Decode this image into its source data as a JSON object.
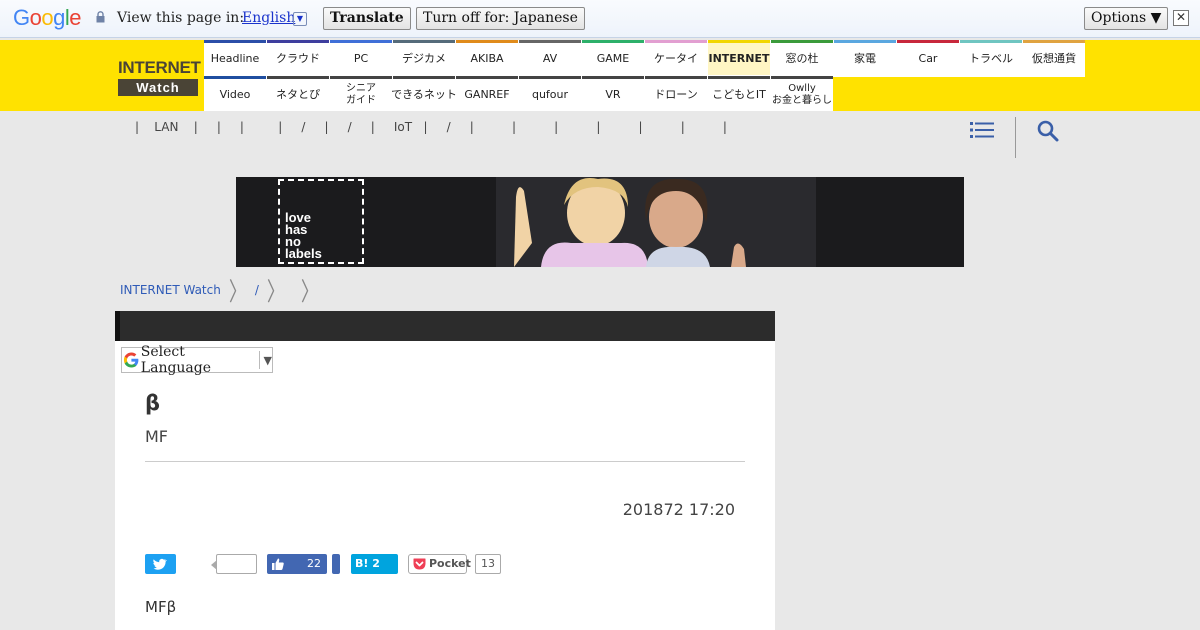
{
  "translate_bar": {
    "logo": "Google",
    "view_text": "View this page in:",
    "language": "English",
    "translate_label": "Translate",
    "turn_off_label": "Turn off for: Japanese",
    "options_label": "Options ▼",
    "close_label": "✕"
  },
  "site": {
    "logo_top": "INTERNET",
    "logo_bottom": "Watch",
    "nav_row1": [
      {
        "label": "Headline",
        "color": "#2b4ea8"
      },
      {
        "label": "クラウド",
        "color": "#3e3e9e"
      },
      {
        "label": "PC",
        "color": "#3f6fd8"
      },
      {
        "label": "デジカメ",
        "color": "#556b7a"
      },
      {
        "label": "AKIBA",
        "color": "#e08b1b"
      },
      {
        "label": "AV",
        "color": "#666666"
      },
      {
        "label": "GAME",
        "color": "#2db06a"
      },
      {
        "label": "ケータイ",
        "color": "#e29fd1"
      },
      {
        "label": "INTERNET",
        "color": "#f2d600"
      },
      {
        "label": "窓の杜",
        "color": "#3b9b3b"
      },
      {
        "label": "家電",
        "color": "#5aa7e0"
      },
      {
        "label": "Car",
        "color": "#c8283c"
      },
      {
        "label": "トラベル",
        "color": "#6fc5c1"
      },
      {
        "label": "仮想通貨",
        "color": "#e0a340"
      }
    ],
    "nav_row2": [
      {
        "label": "Video",
        "color": "#1f4ea0"
      },
      {
        "label": "ネタとぴ",
        "color": "#444444"
      },
      {
        "label": "シニア\nガイド",
        "color": "#444444"
      },
      {
        "label": "できるネット",
        "color": "#444444"
      },
      {
        "label": "GANREF",
        "color": "#444444"
      },
      {
        "label": "qufour",
        "color": "#444444"
      },
      {
        "label": "VR",
        "color": "#444444"
      },
      {
        "label": "ドローン",
        "color": "#444444"
      },
      {
        "label": "こどもとIT",
        "color": "#444444"
      },
      {
        "label": "Owlly\nお金と暮らし",
        "color": "#444444"
      }
    ],
    "subnav": "|    LAN    |     |     |         |     /     |     /     |     IoT   |     /     |          |          |          |          |          |          |"
  },
  "breadcrumb": {
    "home": "INTERNET Watch",
    "slash": "/"
  },
  "banner": {
    "logo_text": "love\nhas\nno\nlabels"
  },
  "article": {
    "language_select": "Select Language",
    "title": "β",
    "subtitle": "MF",
    "date": "201872 17:20",
    "body": "MFβ",
    "share": {
      "fb_count": "22",
      "hatena_label": "B! 2",
      "pocket_label": "Pocket",
      "pocket_count": "13"
    }
  },
  "colors": {
    "brand_yellow": "#ffe200",
    "twitter": "#1da1f2",
    "facebook": "#4267b2",
    "hatena": "#00a4de",
    "pocket": "#ef3f56"
  }
}
